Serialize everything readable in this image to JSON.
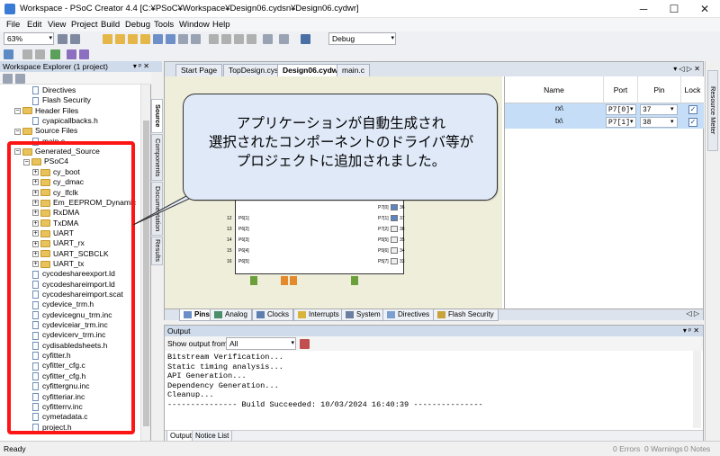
{
  "titlebar": {
    "title": "Workspace - PSoC Creator 4.4  [C:¥PSoC¥Workspace¥Design06.cydsn¥Design06.cydwr]"
  },
  "menu": [
    "File",
    "Edit",
    "View",
    "Project",
    "Build",
    "Debug",
    "Tools",
    "Window",
    "Help"
  ],
  "toolbar": {
    "zoom": "63%",
    "config": "Debug"
  },
  "explorer": {
    "title": "Workspace Explorer (1 project)",
    "pin": "▾ ᵖ ✕",
    "items": [
      {
        "label": "Directives",
        "type": "file",
        "indent": 3
      },
      {
        "label": "Flash Security",
        "type": "file",
        "indent": 3
      },
      {
        "label": "Header Files",
        "type": "folder",
        "indent": 1,
        "exp": "−"
      },
      {
        "label": "cyapicallbacks.h",
        "type": "file",
        "indent": 3
      },
      {
        "label": "Source Files",
        "type": "folder",
        "indent": 1,
        "exp": "−"
      },
      {
        "label": "main.c",
        "type": "file",
        "indent": 3
      },
      {
        "label": "Generated_Source",
        "type": "folder",
        "indent": 1,
        "exp": "−"
      },
      {
        "label": "PSoC4",
        "type": "folder",
        "indent": 2,
        "exp": "−"
      },
      {
        "label": "cy_boot",
        "type": "folder",
        "indent": 3,
        "exp": "+"
      },
      {
        "label": "cy_dmac",
        "type": "folder",
        "indent": 3,
        "exp": "+"
      },
      {
        "label": "cy_lfclk",
        "type": "folder",
        "indent": 3,
        "exp": "+"
      },
      {
        "label": "Em_EEPROM_Dynamic",
        "type": "folder",
        "indent": 3,
        "exp": "+"
      },
      {
        "label": "RxDMA",
        "type": "folder",
        "indent": 3,
        "exp": "+"
      },
      {
        "label": "TxDMA",
        "type": "folder",
        "indent": 3,
        "exp": "+"
      },
      {
        "label": "UART",
        "type": "folder",
        "indent": 3,
        "exp": "+"
      },
      {
        "label": "UART_rx",
        "type": "folder",
        "indent": 3,
        "exp": "+"
      },
      {
        "label": "UART_SCBCLK",
        "type": "folder",
        "indent": 3,
        "exp": "+"
      },
      {
        "label": "UART_tx",
        "type": "folder",
        "indent": 3,
        "exp": "+"
      },
      {
        "label": "cycodeshareexport.ld",
        "type": "file",
        "indent": 3
      },
      {
        "label": "cycodeshareimport.ld",
        "type": "file",
        "indent": 3
      },
      {
        "label": "cycodeshareimport.scat",
        "type": "file",
        "indent": 3
      },
      {
        "label": "cydevice_trm.h",
        "type": "file",
        "indent": 3
      },
      {
        "label": "cydevicegnu_trm.inc",
        "type": "file",
        "indent": 3
      },
      {
        "label": "cydeviceiar_trm.inc",
        "type": "file",
        "indent": 3
      },
      {
        "label": "cydevicerv_trm.inc",
        "type": "file",
        "indent": 3
      },
      {
        "label": "cydisabledsheets.h",
        "type": "file",
        "indent": 3
      },
      {
        "label": "cyfitter.h",
        "type": "file",
        "indent": 3
      },
      {
        "label": "cyfitter_cfg.c",
        "type": "file",
        "indent": 3
      },
      {
        "label": "cyfitter_cfg.h",
        "type": "file",
        "indent": 3
      },
      {
        "label": "cyfittergnu.inc",
        "type": "file",
        "indent": 3
      },
      {
        "label": "cyfitteriar.inc",
        "type": "file",
        "indent": 3
      },
      {
        "label": "cyfitterrv.inc",
        "type": "file",
        "indent": 3
      },
      {
        "label": "cymetadata.c",
        "type": "file",
        "indent": 3
      },
      {
        "label": "project.h",
        "type": "file",
        "indent": 3
      }
    ]
  },
  "vtabs": [
    "Source",
    "Components",
    "Documentation",
    "Results"
  ],
  "doctabs": [
    "Start Page",
    "TopDesign.cysch",
    "Design06.cydwr",
    "main.c"
  ],
  "pintable": {
    "headers": [
      "Name",
      "Port",
      "Pin",
      "Lock"
    ],
    "rows": [
      {
        "name": "rx\\",
        "port": "P7[0]",
        "pin": "37"
      },
      {
        "name": "tx\\",
        "port": "P7[1]",
        "pin": "38"
      }
    ]
  },
  "chip_pins_left": [
    "12",
    "13",
    "14",
    "15",
    "16"
  ],
  "chip_pins_left_labels": [
    "P6[1]",
    "P6[2]",
    "P6[3]",
    "P6[4]",
    "P6[5]"
  ],
  "chip_pins_right": [
    "36",
    "37",
    "38",
    "35",
    "34",
    "33"
  ],
  "chip_pins_right_labels": [
    "P7[0]",
    "P7[1]",
    "P7[2]",
    "P5[5]",
    "P5[6]",
    "P5[7]"
  ],
  "bottomtabs": [
    "Pins",
    "Analog",
    "Clocks",
    "Interrupts",
    "System",
    "Directives",
    "Flash Security"
  ],
  "output": {
    "title": "Output",
    "show_from_label": "Show output from:",
    "show_from_value": "All",
    "lines": [
      "Bitstream Verification...",
      "Static timing analysis...",
      "API Generation...",
      "Dependency Generation...",
      "Cleanup...",
      "--------------- Build Succeeded: 10/03/2024 16:40:39 ---------------"
    ],
    "tabs": [
      "Output",
      "Notice List"
    ]
  },
  "rightrail": {
    "label": "Resource Meter"
  },
  "status": {
    "left": "Ready",
    "errors": "0 Errors",
    "warnings": "0 Warnings",
    "notes": "0 Notes"
  },
  "callout": {
    "lines": [
      "アプリケーションが自動生成され",
      "選択されたコンポーネントのドライバ等が",
      "プロジェクトに追加されました。"
    ]
  },
  "colors": {
    "highlight": "#ff1414",
    "callout_bg": "#dfe9f8",
    "selection_row": "#c5ddf6"
  }
}
